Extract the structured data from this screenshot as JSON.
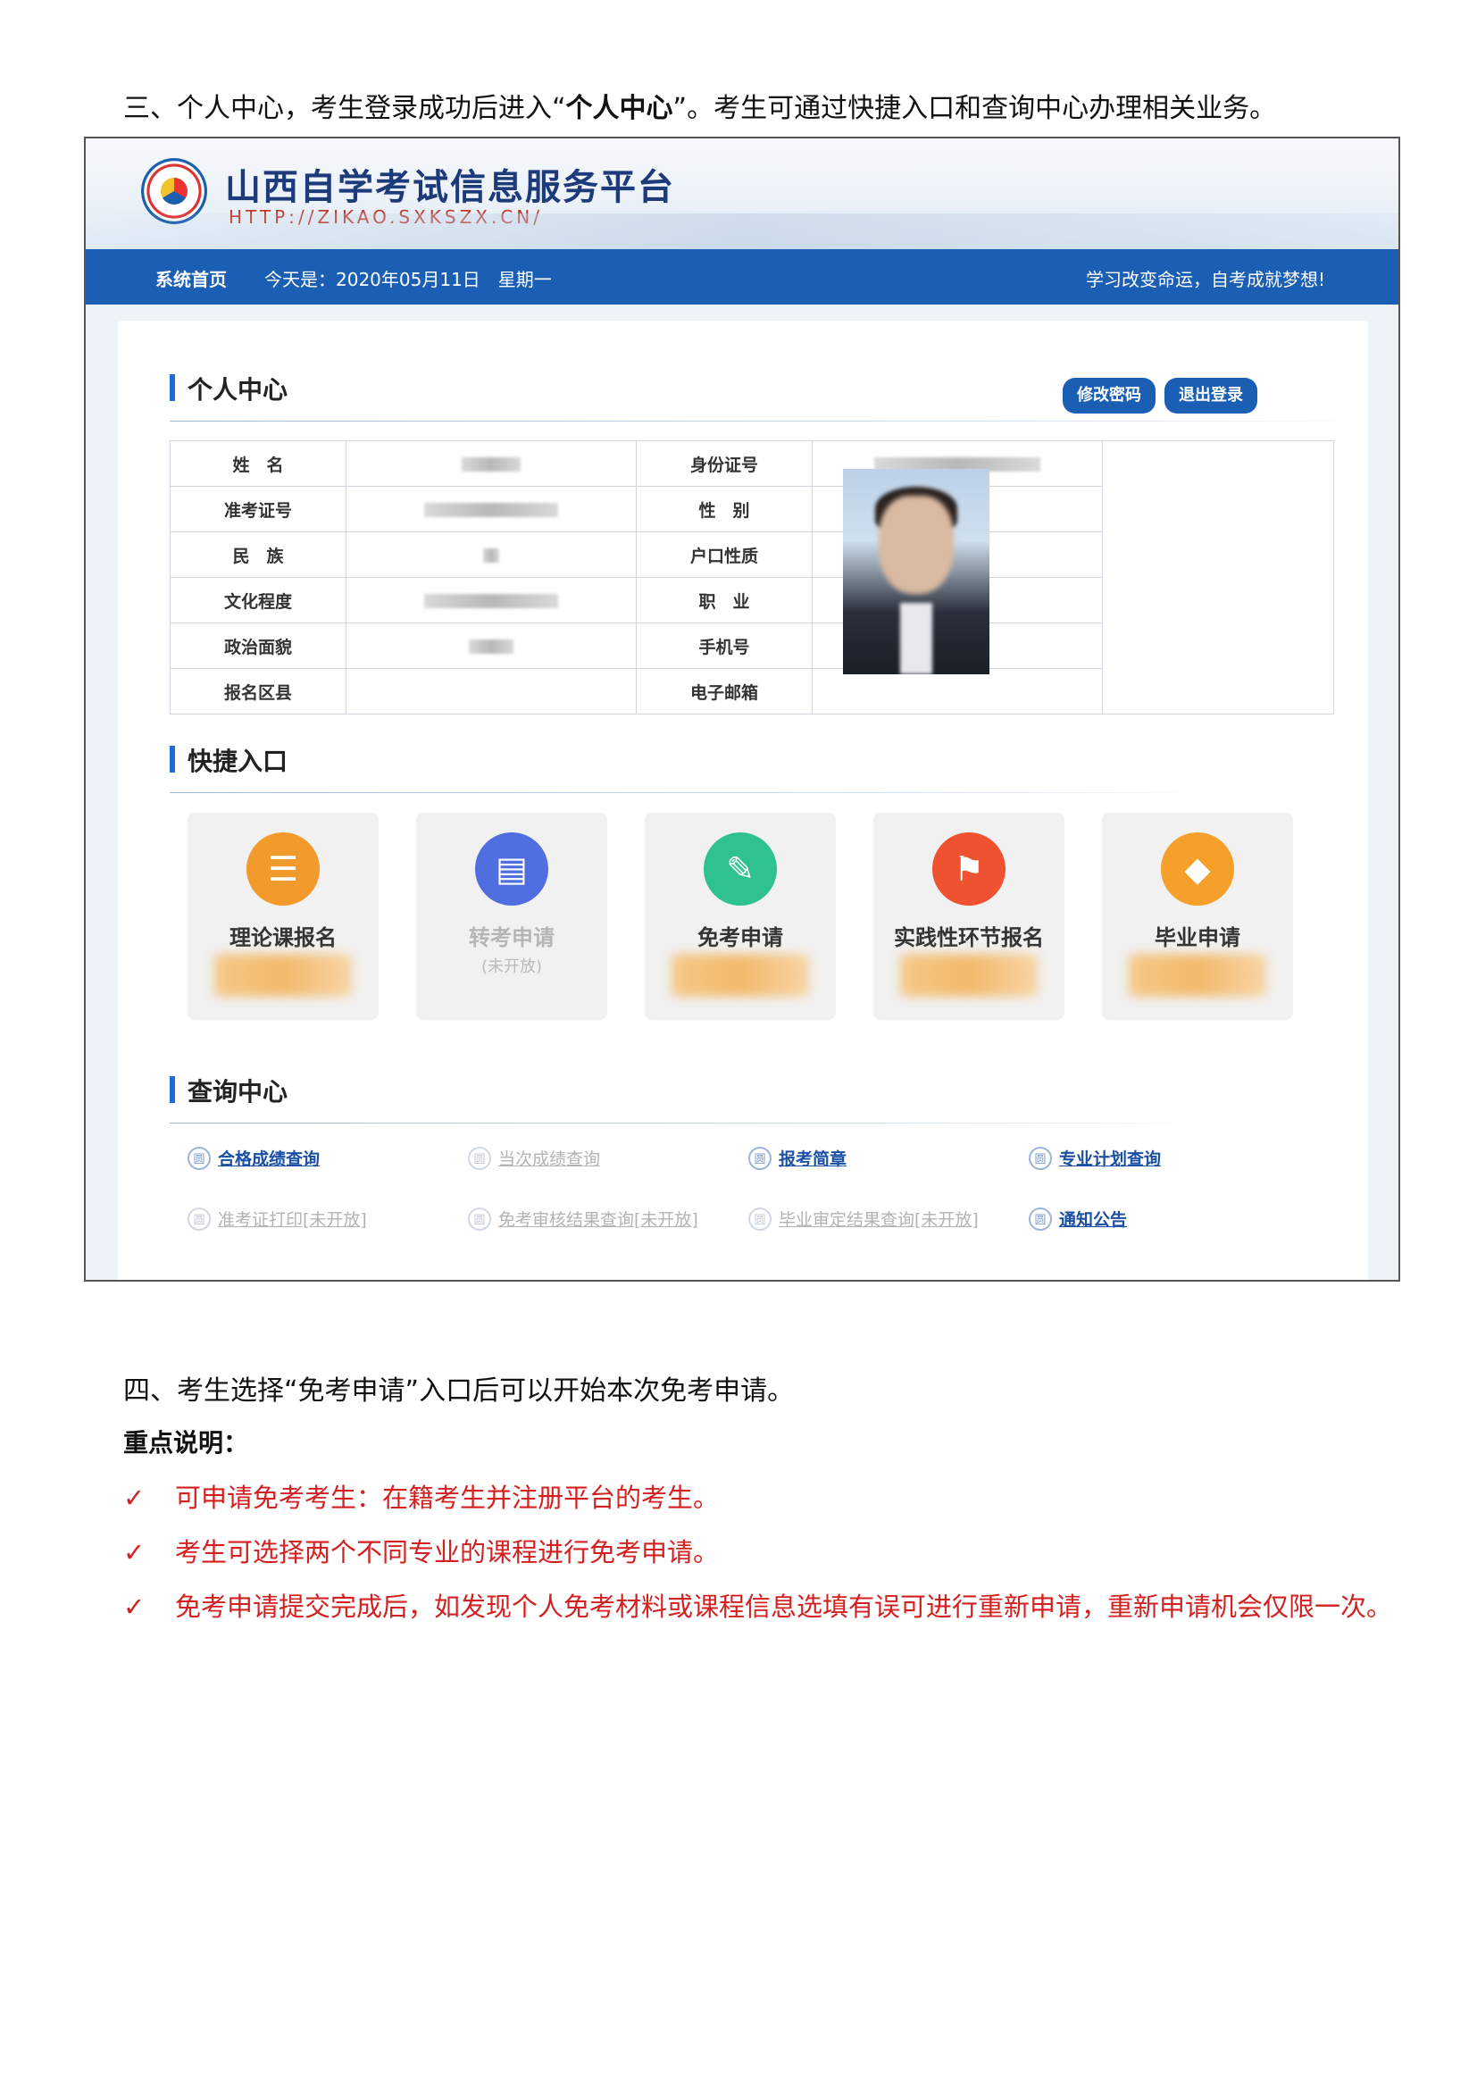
{
  "intro": {
    "prefix": "三、个人中心，考生登录成功后进入“",
    "bold": "个人中心",
    "suffix": "”。考生可通过快捷入口和查询中心办理相关业务。"
  },
  "site": {
    "title": "山西自学考试信息服务平台",
    "url": "HTTP://ZIKAO.SXKSZX.CN/"
  },
  "nav": {
    "home": "系统首页",
    "date": "今天是：2020年05月11日　星期一",
    "motto": "学习改变命运，自考成就梦想!"
  },
  "profile": {
    "title": "个人中心",
    "change_password": "修改密码",
    "logout": "退出登录",
    "labels": {
      "name": "姓　名",
      "id_number": "身份证号",
      "ticket": "准考证号",
      "gender": "性　别",
      "ethnicity": "民　族",
      "household": "户口性质",
      "education": "文化程度",
      "occupation": "职　业",
      "political": "政治面貌",
      "phone": "手机号",
      "district": "报名区县",
      "email": "电子邮箱"
    }
  },
  "shortcuts": {
    "title": "快捷入口",
    "items": [
      {
        "label": "理论课报名",
        "icon": "books-icon",
        "color": "#f39a2c",
        "enabled": true
      },
      {
        "label": "转考申请",
        "sub": "(未开放)",
        "icon": "document-icon",
        "color": "#4f6fe0",
        "enabled": false
      },
      {
        "label": "免考申请",
        "icon": "clipboard-edit-icon",
        "color": "#2fc28e",
        "enabled": true
      },
      {
        "label": "实践性环节报名",
        "icon": "flag-icon",
        "color": "#ee5230",
        "enabled": true
      },
      {
        "label": "毕业申请",
        "icon": "graduation-cap-icon",
        "color": "#f4a02a",
        "enabled": true
      }
    ]
  },
  "query": {
    "title": "查询中心",
    "links": [
      {
        "label": "合格成绩查询",
        "enabled": true
      },
      {
        "label": "当次成绩查询",
        "enabled": false
      },
      {
        "label": "报考简章",
        "enabled": true
      },
      {
        "label": "专业计划查询",
        "enabled": true
      },
      {
        "label": "准考证打印[未开放]",
        "enabled": false
      },
      {
        "label": "免考审核结果查询[未开放]",
        "enabled": false
      },
      {
        "label": "毕业审定结果查询[未开放]",
        "enabled": false
      },
      {
        "label": "通知公告",
        "enabled": true
      }
    ],
    "icon_glyph": "圆"
  },
  "section4": {
    "heading": "四、考生选择“免考申请”入口后可以开始本次免考申请。",
    "key_title": "重点说明：",
    "check_glyph": "✓",
    "notes": [
      "可申请免考考生：在籍考生并注册平台的考生。",
      "考生可选择两个不同专业的课程进行免考申请。",
      "免考申请提交完成后，如发现个人免考材料或课程信息选填有误可进行重新申请，重新申请机会仅限一次。"
    ]
  }
}
